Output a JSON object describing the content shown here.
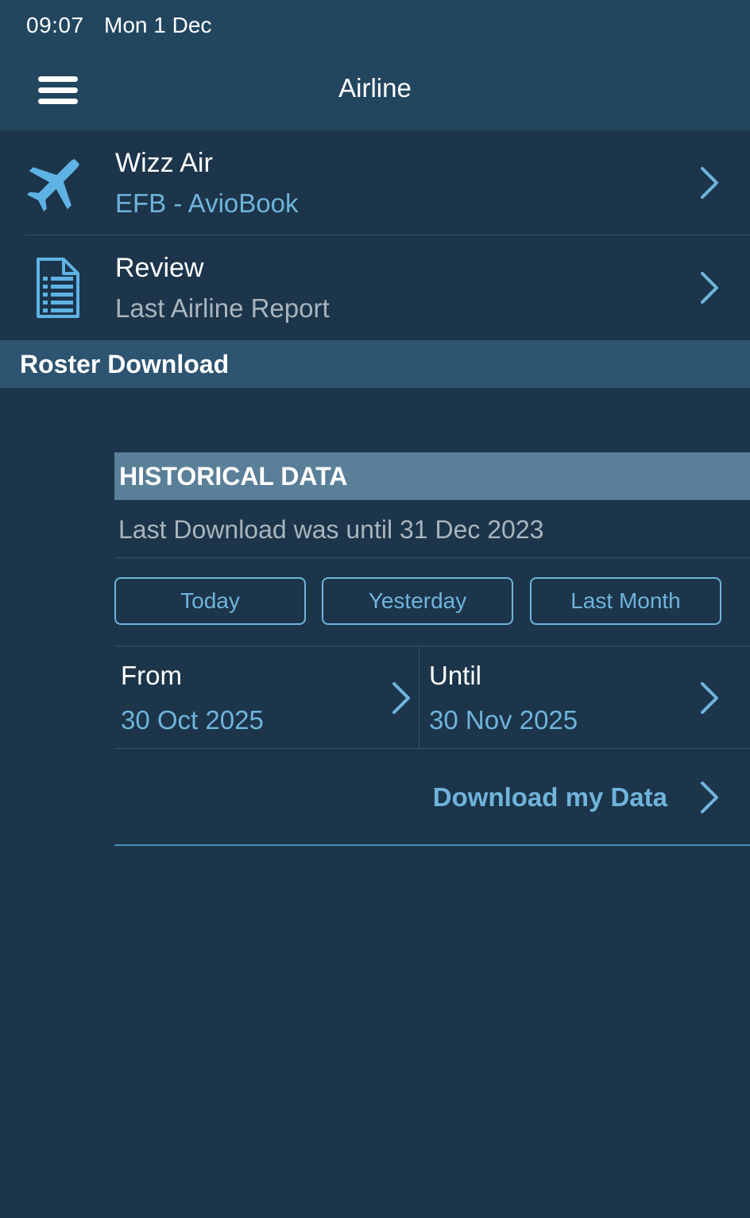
{
  "status_bar": {
    "time": "09:07",
    "date": "Mon 1 Dec"
  },
  "nav": {
    "title": "Airline"
  },
  "airline_row": {
    "name": "Wizz Air",
    "subtitle": "EFB - AvioBook"
  },
  "review_row": {
    "title": "Review",
    "subtitle": "Last Airline Report"
  },
  "roster_section": {
    "title": "Roster Download"
  },
  "historical": {
    "title": "HISTORICAL DATA",
    "last_download": "Last Download was until 31 Dec 2023",
    "quick_buttons": [
      "Today",
      "Yesterday",
      "Last Month"
    ],
    "from_label": "From",
    "from_value": "30 Oct 2025",
    "until_label": "Until",
    "until_value": "30 Nov 2025",
    "download_label": "Download my Data"
  },
  "colors": {
    "background": "#1c354a",
    "header": "#23465f",
    "section": "#2d5470",
    "historical_header": "#5a7f98",
    "accent": "#6fb4dc",
    "muted_text": "#a9b4bd"
  },
  "icons": {
    "menu": "hamburger-menu-icon",
    "airline": "airplane-icon",
    "review": "document-icon",
    "disclosure": "chevron-right-icon"
  }
}
